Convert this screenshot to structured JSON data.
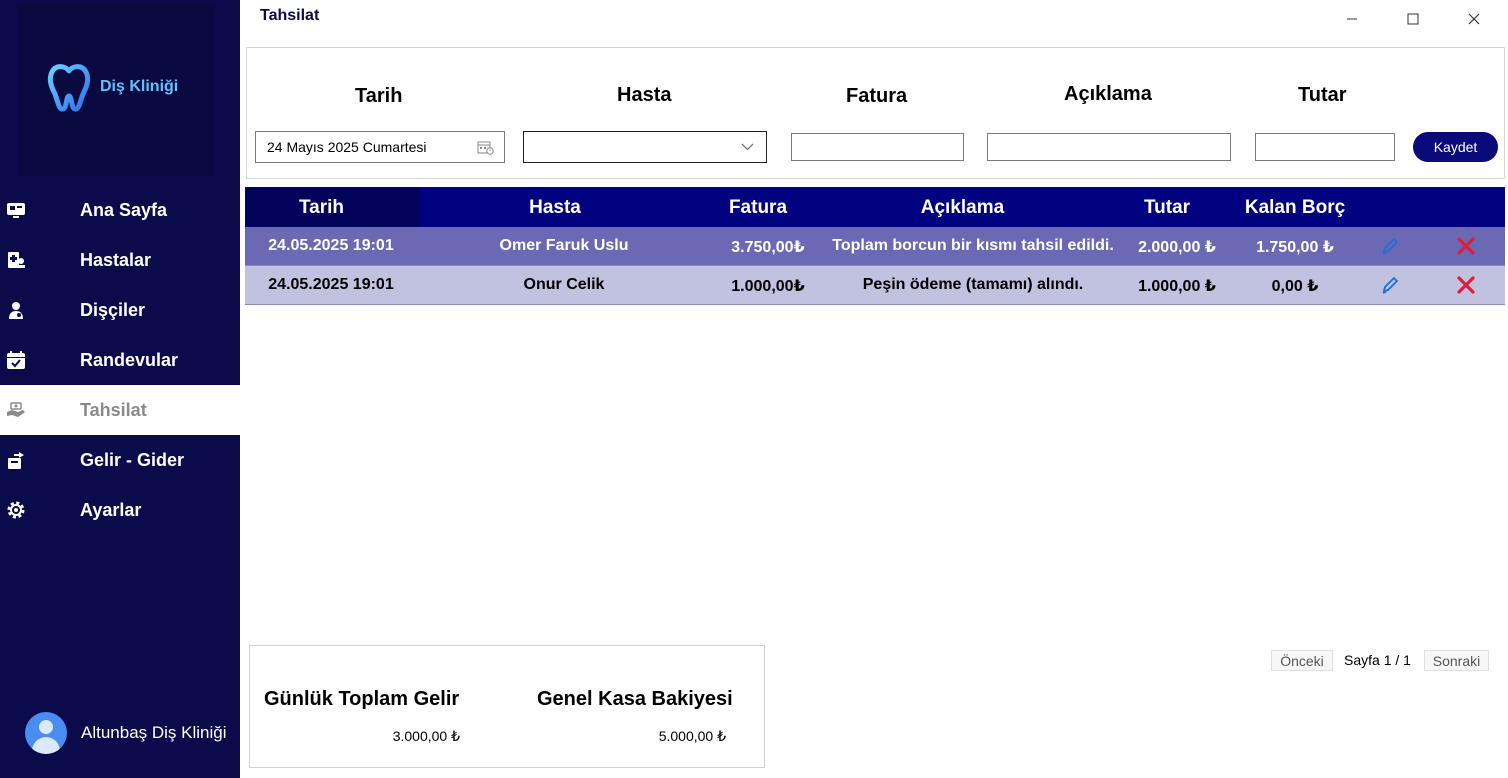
{
  "app": {
    "logo_text": "Diş Kliniği",
    "window_title": "Tahsilat"
  },
  "sidebar": {
    "items": [
      {
        "label": "Ana Sayfa",
        "icon": "dashboard-icon"
      },
      {
        "label": "Hastalar",
        "icon": "patients-icon"
      },
      {
        "label": "Dişçiler",
        "icon": "dentists-icon"
      },
      {
        "label": "Randevular",
        "icon": "calendar-icon"
      },
      {
        "label": "Tahsilat",
        "icon": "payment-icon",
        "active": true
      },
      {
        "label": "Gelir - Gider",
        "icon": "income-expense-icon"
      },
      {
        "label": "Ayarlar",
        "icon": "settings-icon"
      }
    ],
    "user_name": "Altunbaş Diş Kliniği"
  },
  "form": {
    "labels": {
      "date": "Tarih",
      "patient": "Hasta",
      "invoice": "Fatura",
      "description": "Açıklama",
      "amount": "Tutar"
    },
    "date_value": "24 Mayıs 2025 Cumartesi",
    "patient_value": "",
    "invoice_value": "",
    "description_value": "",
    "amount_value": "",
    "save_label": "Kaydet"
  },
  "table": {
    "headers": [
      "Tarih",
      "Hasta",
      "Fatura",
      "Açıklama",
      "Tutar",
      "Kalan Borç"
    ],
    "rows": [
      {
        "date": "24.05.2025 19:01",
        "patient": "Omer Faruk Uslu",
        "invoice": "3.750,00₺",
        "description": "Toplam borcun bir kısmı tahsil edildi.",
        "amount": "2.000,00 ₺",
        "remaining": "1.750,00 ₺"
      },
      {
        "date": "24.05.2025 19:01",
        "patient": "Onur Celik",
        "invoice": "1.000,00₺",
        "description": "Peşin ödeme (tamamı) alındı.",
        "amount": "1.000,00 ₺",
        "remaining": "0,00 ₺"
      }
    ]
  },
  "summary": {
    "daily_income_label": "Günlük Toplam Gelir",
    "daily_income_value": "3.000,00 ₺",
    "cash_balance_label": "Genel Kasa Bakiyesi",
    "cash_balance_value": "5.000,00 ₺"
  },
  "pagination": {
    "prev_label": "Önceki",
    "page_label": "Sayfa 1 / 1",
    "next_label": "Sonraki"
  },
  "colors": {
    "sidebar_bg": "#0b0a4a",
    "header_bg": "#020280",
    "row1_bg": "#6b69b3",
    "row2_bg": "#c1c1e0",
    "accent_button": "#0b0a7a",
    "delete_red": "#e01c3c",
    "edit_blue": "#1f6fd6"
  }
}
